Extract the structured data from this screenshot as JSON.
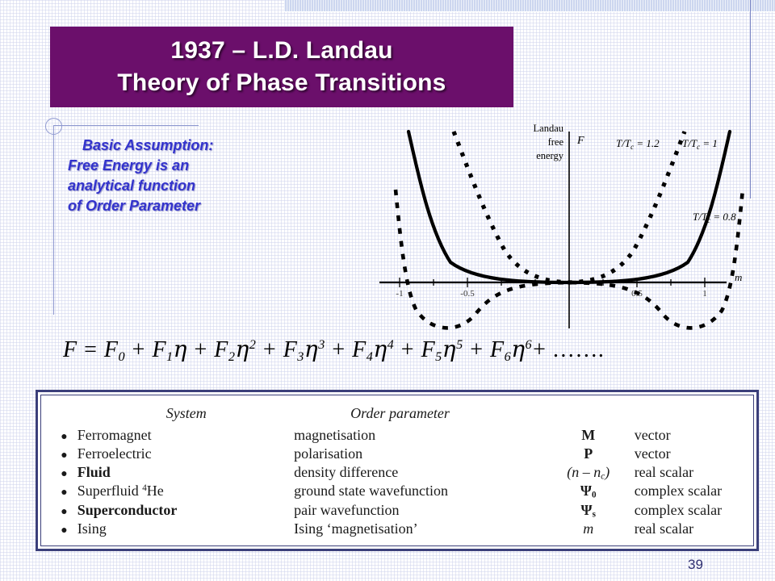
{
  "slide": {
    "page_number": "39",
    "accent_color": "#6b0f6b",
    "text_color": "#3333cc",
    "frame_color": "#3b3f7a",
    "band_color": "#ccd6ef"
  },
  "title": {
    "line1": "1937 – L.D. Landau",
    "line2": "Theory of Phase Transitions"
  },
  "assumption": {
    "line1": "Basic Assumption:",
    "line2": "Free Energy is an",
    "line3": "analytical function",
    "line4": "of Order Parameter"
  },
  "equation": {
    "lhs": "F",
    "equals": "=",
    "terms": [
      {
        "coef": "F",
        "coef_sub": "0",
        "var": "",
        "power": ""
      },
      {
        "coef": "F",
        "coef_sub": "1",
        "var": "η",
        "power": ""
      },
      {
        "coef": "F",
        "coef_sub": "2",
        "var": "η",
        "power": "2"
      },
      {
        "coef": "F",
        "coef_sub": "3",
        "var": "η",
        "power": "3"
      },
      {
        "coef": "F",
        "coef_sub": "4",
        "var": "η",
        "power": "4"
      },
      {
        "coef": "F",
        "coef_sub": "5",
        "var": "η",
        "power": "5"
      },
      {
        "coef": "F",
        "coef_sub": "6",
        "var": "η",
        "power": "6"
      }
    ],
    "tail": "+ …….",
    "plain": "F = F0 + F1η + F2η2 + F3η3 + F4η4 + F5η5 + F6η6 + ……."
  },
  "chart_data": {
    "type": "line",
    "title": "",
    "ylabel_block": [
      "Landau",
      "free",
      "energy"
    ],
    "ylabel_axis": "F",
    "xlabel": "m",
    "xlim": [
      -1.15,
      1.15
    ],
    "xticks": [
      -1,
      -0.5,
      0.5,
      1
    ],
    "xticklabels": [
      "-1",
      "-0.5",
      "0.5",
      "1"
    ],
    "grid": false,
    "legend_position": "inline-annotations",
    "series": [
      {
        "name": "T/Tc = 1.2",
        "label": "T/T",
        "label_sub": "c",
        "label_tail": " = 1.2",
        "style": "dotted",
        "minimum_m": 0.0,
        "description": "single well, steep quadratic above Tc",
        "x": [
          -1.0,
          -0.9,
          -0.8,
          -0.7,
          -0.6,
          -0.5,
          -0.4,
          -0.3,
          -0.2,
          -0.1,
          0.0,
          0.1,
          0.2,
          0.3,
          0.4,
          0.5,
          0.6,
          0.7,
          0.8,
          0.9,
          1.0
        ],
        "y": [
          1.2,
          0.93,
          0.71,
          0.52,
          0.37,
          0.25,
          0.16,
          0.09,
          0.04,
          0.01,
          0.0,
          0.01,
          0.04,
          0.09,
          0.16,
          0.25,
          0.37,
          0.52,
          0.71,
          0.93,
          1.2
        ]
      },
      {
        "name": "T/Tc = 1",
        "label": "T/T",
        "label_sub": "c",
        "label_tail": " = 1",
        "style": "solid",
        "minimum_m": 0.0,
        "description": "flat quartic at Tc",
        "x": [
          -1.0,
          -0.9,
          -0.8,
          -0.7,
          -0.6,
          -0.5,
          -0.4,
          -0.3,
          -0.2,
          -0.1,
          0.0,
          0.1,
          0.2,
          0.3,
          0.4,
          0.5,
          0.6,
          0.7,
          0.8,
          0.9,
          1.0
        ],
        "y": [
          1.0,
          0.66,
          0.41,
          0.24,
          0.13,
          0.06,
          0.026,
          0.008,
          0.0016,
          0.0001,
          0.0,
          0.0001,
          0.0016,
          0.008,
          0.026,
          0.06,
          0.13,
          0.24,
          0.41,
          0.66,
          1.0
        ]
      },
      {
        "name": "T/Tc = 0.8",
        "label": "T/T",
        "label_sub": "c",
        "label_tail": " = 0.8",
        "style": "dashed",
        "minimum_m": 0.72,
        "description": "double well below Tc with minima near m = ±0.72",
        "x": [
          -1.0,
          -0.9,
          -0.8,
          -0.72,
          -0.6,
          -0.5,
          -0.4,
          -0.3,
          -0.2,
          -0.1,
          0.0,
          0.1,
          0.2,
          0.3,
          0.4,
          0.5,
          0.6,
          0.72,
          0.8,
          0.9,
          1.0
        ],
        "y": [
          0.47,
          -0.12,
          -0.34,
          -0.38,
          -0.31,
          -0.23,
          -0.15,
          -0.08,
          -0.035,
          -0.009,
          0.0,
          -0.009,
          -0.035,
          -0.08,
          -0.15,
          -0.23,
          -0.31,
          -0.38,
          -0.34,
          -0.12,
          0.47
        ]
      }
    ]
  },
  "table": {
    "headers": {
      "system": "System",
      "order_parameter": "Order parameter"
    },
    "bullet": "●",
    "rows": [
      {
        "bullet": "●",
        "system": "Ferromagnet",
        "system_bold": false,
        "parameter": "magnetisation",
        "symbol": "M",
        "symbol_style": "bold",
        "type": "vector"
      },
      {
        "bullet": "●",
        "system": "Ferroelectric",
        "system_bold": false,
        "parameter": "polarisation",
        "symbol": "P",
        "symbol_style": "bold",
        "type": "vector"
      },
      {
        "bullet": "●",
        "system": "Fluid",
        "system_bold": true,
        "parameter": "density difference",
        "symbol": "(n – n_c)",
        "symbol_style": "italic",
        "type": "real scalar"
      },
      {
        "bullet": "●",
        "system": "Superfluid 4He",
        "system_sup": "4",
        "system_base": "Superfluid",
        "system_tail": "He",
        "system_bold": false,
        "parameter": "ground state wavefunction",
        "symbol": "Ψ0",
        "symbol_style": "bold",
        "type": "complex scalar"
      },
      {
        "bullet": "●",
        "system": "Superconductor",
        "system_bold": true,
        "parameter": "pair wavefunction",
        "symbol": "Ψs",
        "symbol_style": "bold",
        "type": "complex scalar"
      },
      {
        "bullet": "●",
        "system": "Ising",
        "system_bold": false,
        "parameter": "Ising ‘magnetisation’",
        "symbol": "m",
        "symbol_style": "italic",
        "type": "real scalar"
      }
    ]
  }
}
